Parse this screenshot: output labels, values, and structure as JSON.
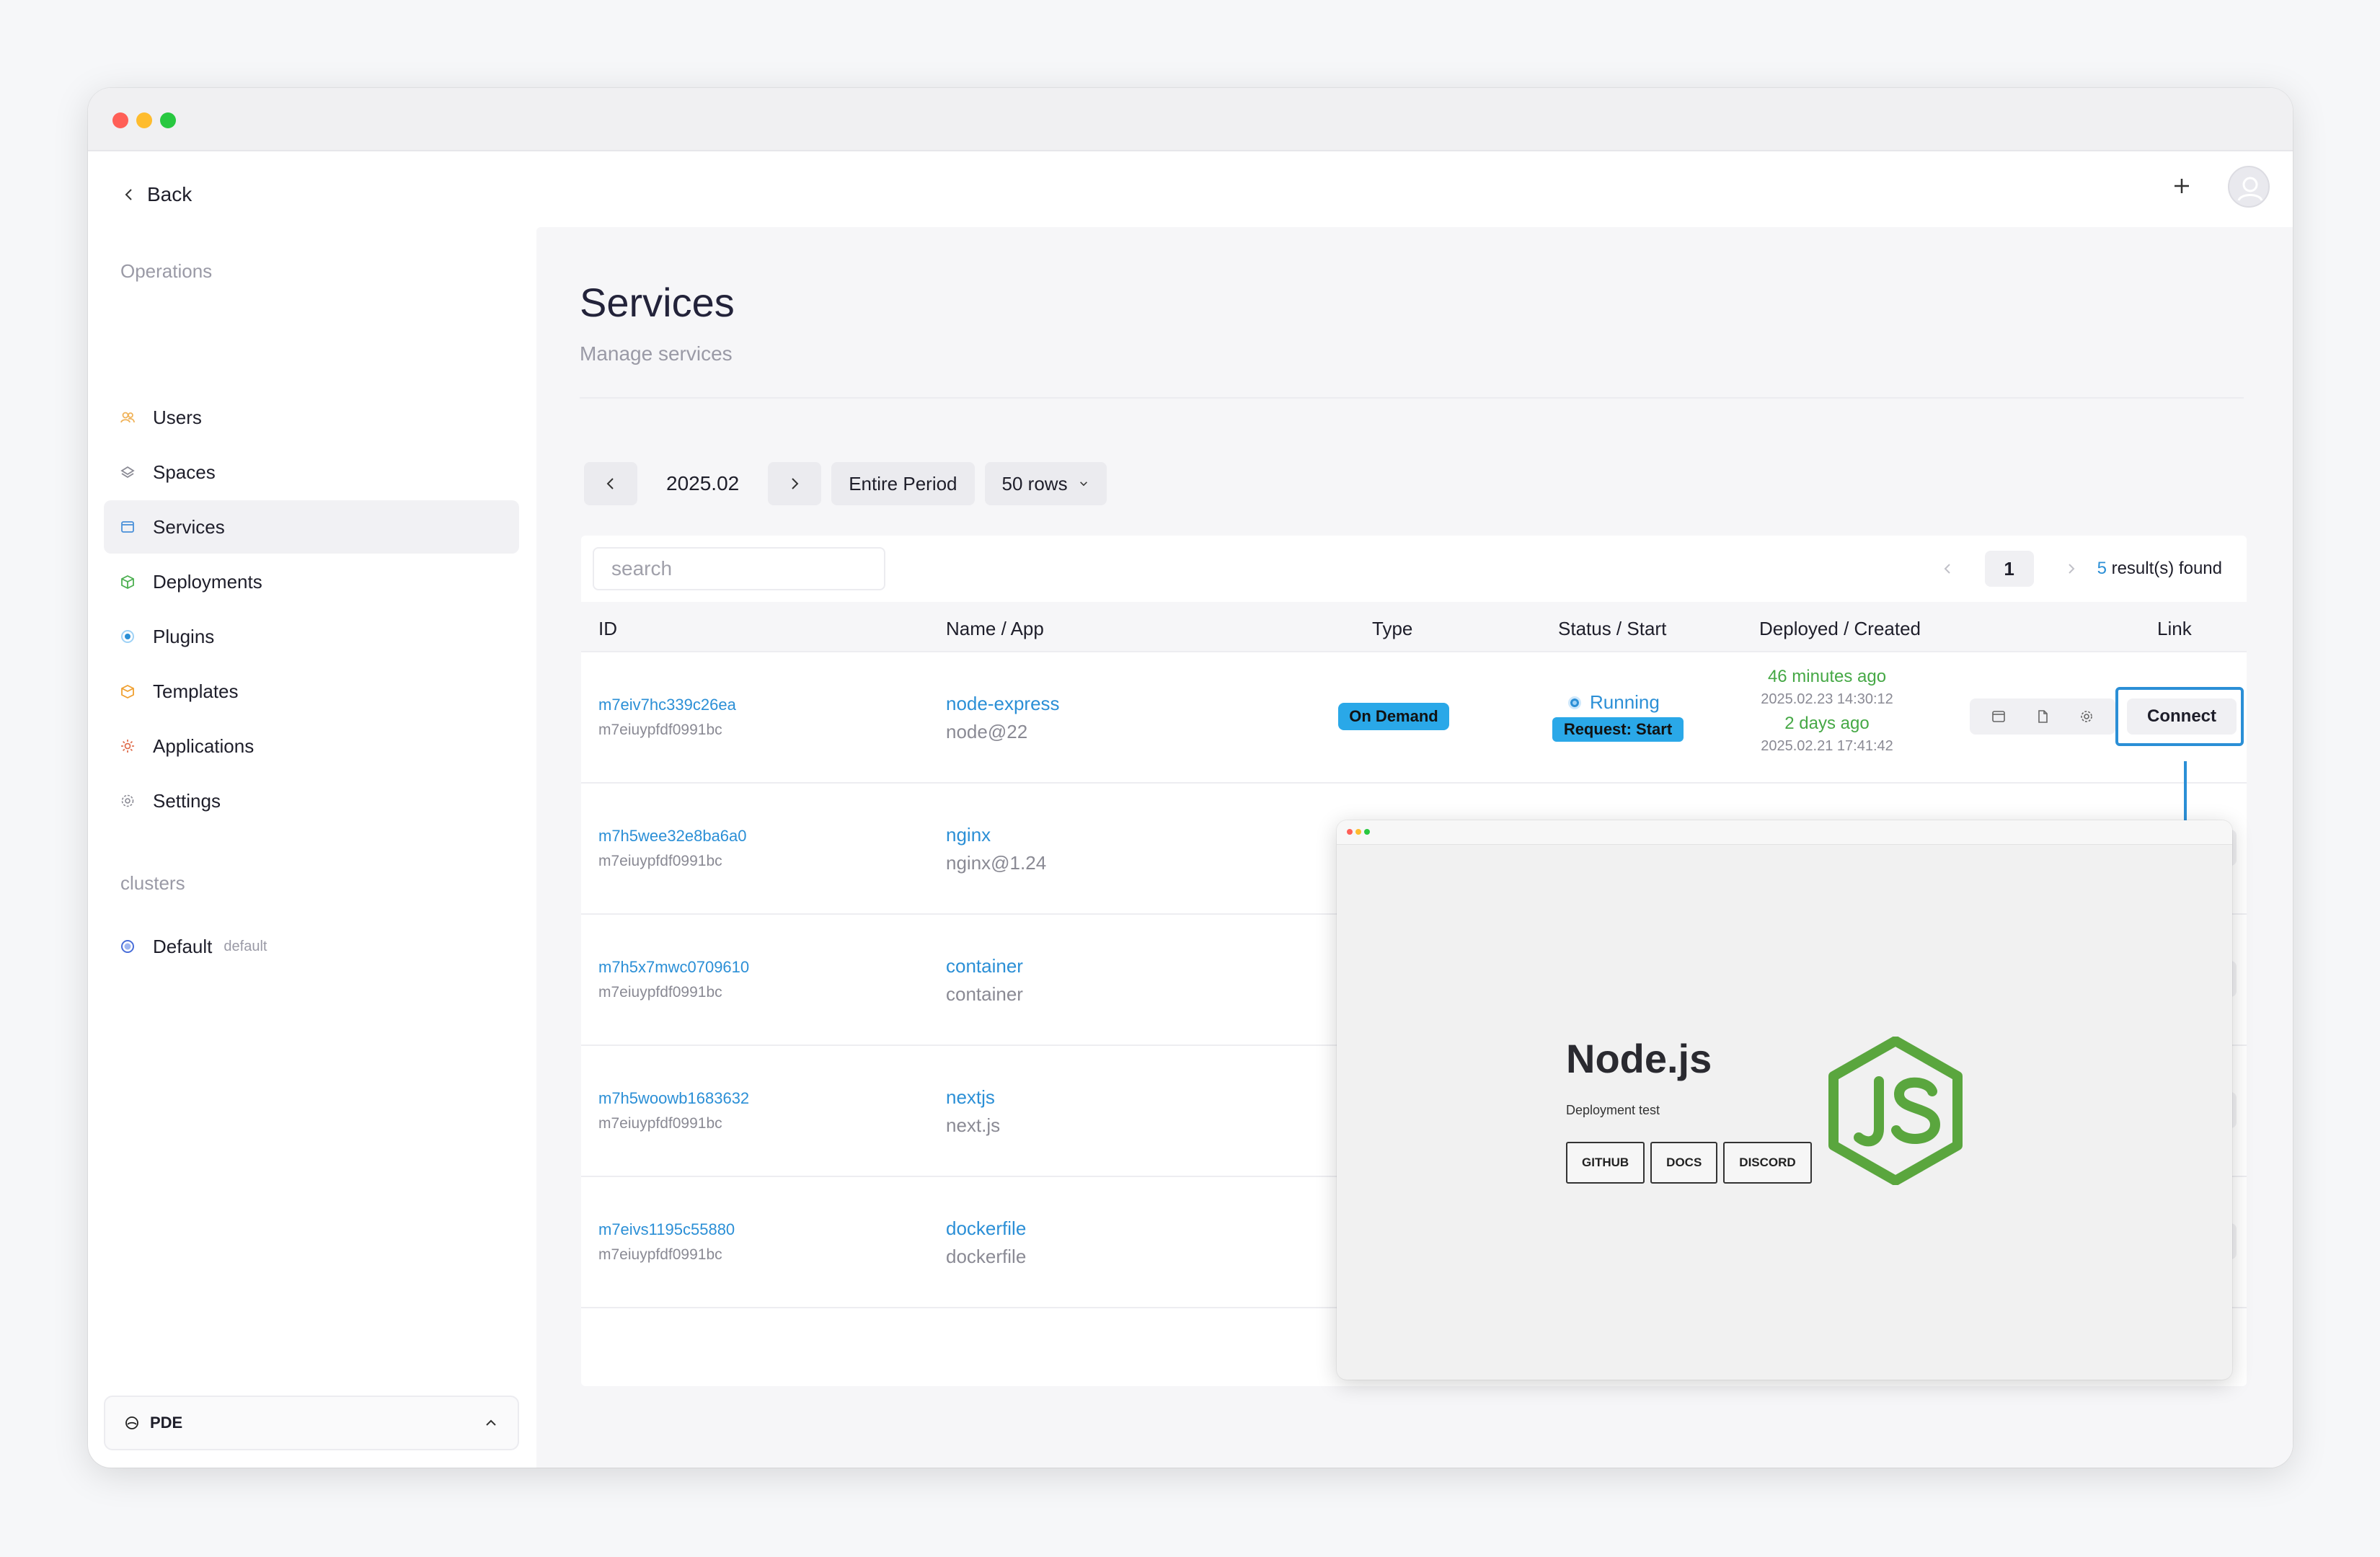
{
  "sidebar": {
    "back_label": "Back",
    "operations_title": "Operations",
    "items": [
      {
        "label": "Users",
        "icon": "users-icon",
        "color": "#f0b35a"
      },
      {
        "label": "Spaces",
        "icon": "layers-icon",
        "color": "#8a8a94"
      },
      {
        "label": "Services",
        "icon": "window-icon",
        "color": "#4a90d9"
      },
      {
        "label": "Deployments",
        "icon": "box-icon",
        "color": "#4caf50"
      },
      {
        "label": "Plugins",
        "icon": "plugin-icon",
        "color": "#2b8fd6"
      },
      {
        "label": "Templates",
        "icon": "package-icon",
        "color": "#f0a030"
      },
      {
        "label": "Applications",
        "icon": "gear-icon",
        "color": "#e07050"
      },
      {
        "label": "Settings",
        "icon": "settings-icon",
        "color": "#8a8a94"
      }
    ],
    "clusters_title": "clusters",
    "cluster": {
      "label": "Default",
      "tag": "default"
    },
    "footer_label": "PDE"
  },
  "header": {
    "plus_icon": "plus-icon",
    "avatar_icon": "user-avatar-icon"
  },
  "main": {
    "title": "Services",
    "subtitle": "Manage services",
    "filters": {
      "period": "2025.02",
      "range_label": "Entire Period",
      "rows_label": "50 rows"
    },
    "search": {
      "placeholder": "search",
      "value": ""
    },
    "pager": {
      "page": "1",
      "count": "5",
      "found_label": " result(s) found"
    },
    "columns": [
      "ID",
      "Name / App",
      "Type",
      "Status / Start",
      "Deployed / Created",
      "Link"
    ],
    "rows": [
      {
        "id": "m7eiv7hc339c26ea",
        "sub_id": "m7eiuypfdf0991bc",
        "name": "node-express",
        "app": "node@22",
        "type": "On Demand",
        "status": "Running",
        "start": "Request: Start",
        "deployed_ago": "46 minutes ago",
        "deployed_ts": "2025.02.23 14:30:12",
        "created_ago": "2 days ago",
        "created_ts": "2025.02.21 17:41:42",
        "link_label": "Connect"
      },
      {
        "id": "m7h5wee32e8ba6a0",
        "sub_id": "m7eiuypfdf0991bc",
        "name": "nginx",
        "app": "nginx@1.24"
      },
      {
        "id": "m7h5x7mwc0709610",
        "sub_id": "m7eiuypfdf0991bc",
        "name": "container",
        "app": "container"
      },
      {
        "id": "m7h5woowb1683632",
        "sub_id": "m7eiuypfdf0991bc",
        "name": "nextjs",
        "app": "next.js"
      },
      {
        "id": "m7eivs1195c55880",
        "sub_id": "m7eiuypfdf0991bc",
        "name": "dockerfile",
        "app": "dockerfile"
      }
    ]
  },
  "popup": {
    "title": "Node.js",
    "subtitle": "Deployment test",
    "buttons": [
      "GITHUB",
      "DOCS",
      "DISCORD"
    ],
    "logo_icon": "nodejs-logo-icon",
    "logo_color": "#5aa63e"
  },
  "colors": {
    "accent": "#2b8fd6",
    "badge": "#2aa8e8",
    "success": "#45a845"
  }
}
